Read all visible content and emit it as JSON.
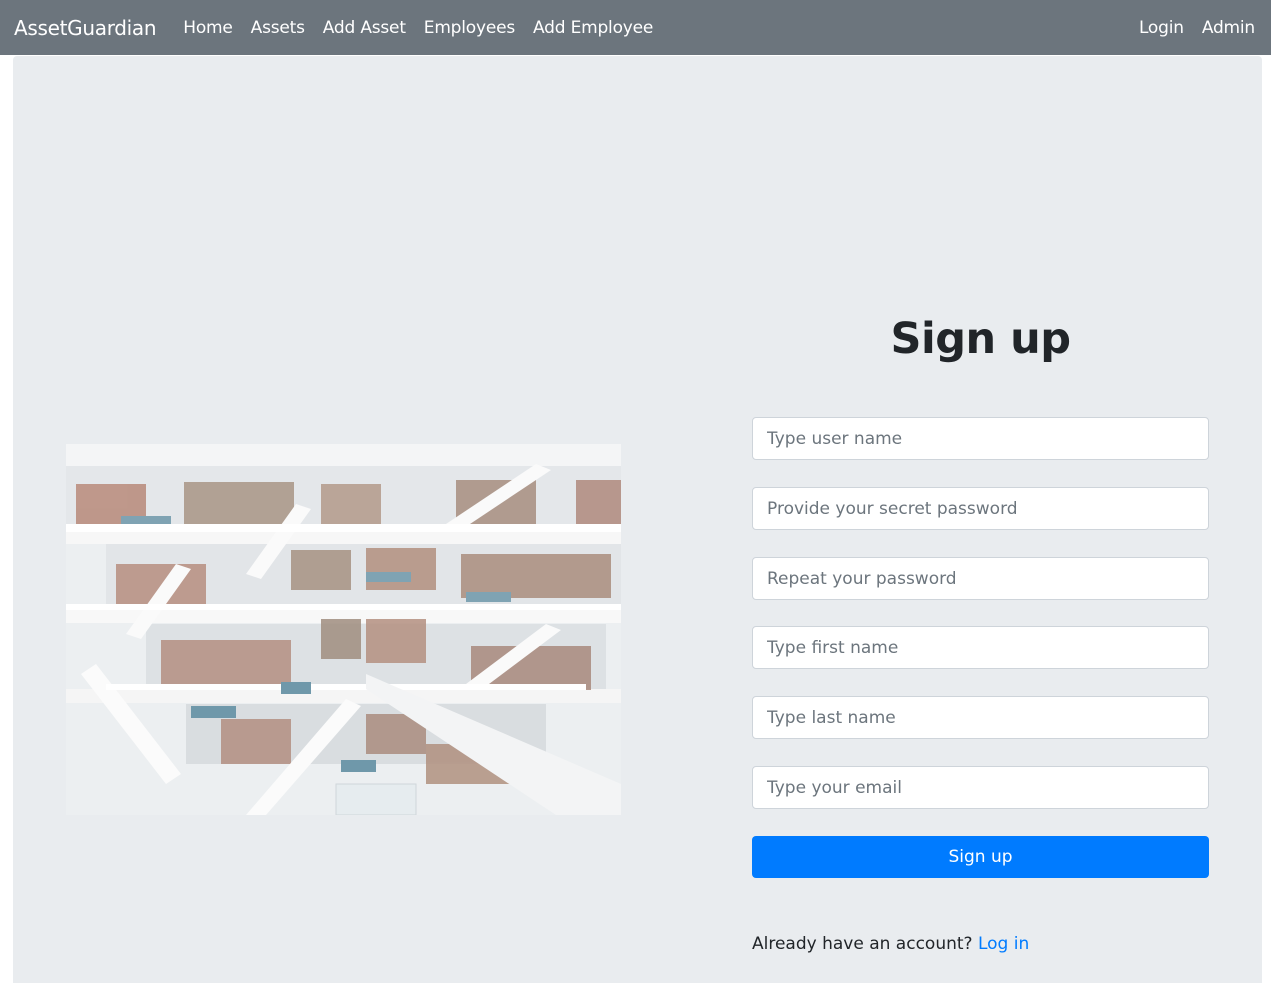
{
  "navbar": {
    "brand": "AssetGuardian",
    "left_links": [
      "Home",
      "Assets",
      "Add Asset",
      "Employees",
      "Add Employee"
    ],
    "right_links": [
      "Login",
      "Admin"
    ],
    "background_color": "#6c757d"
  },
  "main": {
    "title": "Sign up",
    "image_icon": "library-interior-photo",
    "fields": [
      {
        "placeholder": "Type user name",
        "value": ""
      },
      {
        "placeholder": "Provide your secret password",
        "value": ""
      },
      {
        "placeholder": "Repeat your password",
        "value": ""
      },
      {
        "placeholder": "Type first name",
        "value": ""
      },
      {
        "placeholder": "Type last name",
        "value": ""
      },
      {
        "placeholder": "Type your email",
        "value": ""
      }
    ],
    "submit_label": "Sign up",
    "footer_prompt": "Already have an account?",
    "footer_link": "Log in",
    "accent_color": "#007bff",
    "panel_color": "#e9ecef"
  }
}
